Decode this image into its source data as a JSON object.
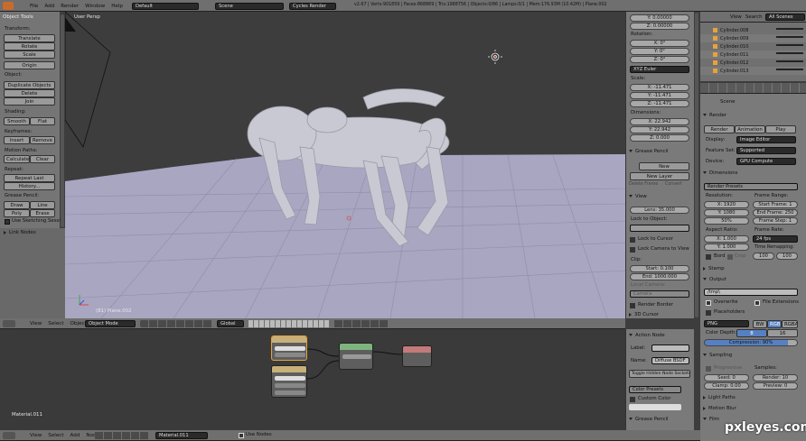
{
  "topbar": {
    "menus": [
      "File",
      "Add",
      "Render",
      "Window",
      "Help"
    ],
    "layout": "Default",
    "scene": "Scene",
    "engine": "Cycles Render",
    "stats": "v2.67 | Verts:901859 | Faces:868869 | Tris:1988756 | Objects:0/86 | Lamps:0/1 | Mem:176.93M (10.42M) | Plane.002"
  },
  "tools": {
    "title": "Object Tools",
    "transform_label": "Transform:",
    "translate": "Translate",
    "rotate": "Rotate",
    "scale": "Scale",
    "origin": "Origin",
    "object_label": "Object:",
    "duplicate": "Duplicate Objects",
    "delete": "Delete",
    "join": "Join",
    "shading_label": "Shading:",
    "smooth": "Smooth",
    "flat": "Flat",
    "keyframes_label": "Keyframes:",
    "insert": "Insert",
    "remove": "Remove",
    "motion_label": "Motion Paths:",
    "calculate": "Calculate",
    "clear": "Clear",
    "repeat_label": "Repeat:",
    "repeat_last": "Repeat Last",
    "history": "History...",
    "grease_label": "Grease Pencil:",
    "draw": "Draw",
    "line": "Line",
    "poly": "Poly",
    "erase": "Erase",
    "sketching": "Use Sketching Sessi",
    "link_nodes": "Link Nodes"
  },
  "viewport": {
    "label": "User Persp",
    "object_name": "(81) Plane.002"
  },
  "viewport_header": {
    "view": "View",
    "select": "Select",
    "object": "Object",
    "mode": "Object Mode",
    "orientation": "Global"
  },
  "props": {
    "y_loc": "Y: 0.00000",
    "z_loc": "Z: 0.00000",
    "rotation_label": "Rotation:",
    "rx": "X: 0°",
    "ry": "Y: 0°",
    "rz": "Z: 0°",
    "rot_mode": "XYZ Euler",
    "scale_label": "Scale:",
    "sx": "X: -11.471",
    "sy": "Y: -11.471",
    "sz": "Z: -11.471",
    "dim_label": "Dimensions:",
    "dx": "X: 22.942",
    "dy": "Y: 22.942",
    "dz": "Z: 0.000",
    "grease": "Grease Pencil",
    "new": "New",
    "new_layer": "New Layer",
    "delete_frame": "Delete Frame",
    "convert": "Convert",
    "view": "View",
    "lens": "Lens: 35.000",
    "lock_obj": "Lock to Object:",
    "lock_cursor": "Lock to Cursor",
    "lock_camera": "Lock Camera to View",
    "clip": "Clip:",
    "start": "Start: 0.100",
    "end": "End: 1000.000",
    "local_camera": "Local Camera:",
    "camera": "Camera",
    "render_border": "Render Border",
    "cursor_3d": "3D Cursor"
  },
  "outliner": {
    "view": "View",
    "search": "Search",
    "all_scenes": "All Scenes",
    "items": [
      "Cylinder.008",
      "Cylinder.009",
      "Cylinder.010",
      "Cylinder.011",
      "Cylinder.012",
      "Cylinder.013"
    ]
  },
  "render": {
    "scene": "Scene",
    "render_hdr": "Render",
    "render_btn": "Render",
    "animation_btn": "Animation",
    "play_btn": "Play",
    "display_label": "Display:",
    "display_val": "Image Editor",
    "feature_label": "Feature Set:",
    "feature_val": "Supported",
    "device_label": "Device:",
    "device_val": "GPU Compute",
    "dimensions": "Dimensions",
    "presets": "Render Presets",
    "resolution": "Resolution:",
    "resx": "X: 1920",
    "resy": "Y: 1080",
    "respct": "50%",
    "frame_range": "Frame Range:",
    "start_frame": "Start Frame: 1",
    "end_frame": "End Frame: 250",
    "frame_step": "Frame Step: 1",
    "aspect": "Aspect Ratio:",
    "ax": "X: 1.000",
    "ay": "Y: 1.000",
    "frame_rate": "Frame Rate:",
    "fps": "24 fps",
    "time_remap": "Time Remapping:",
    "t_old": "100",
    "t_new": "100",
    "border": "Bord",
    "crop": "Crop",
    "stamp": "Stamp",
    "output": "Output",
    "path": "/tmp\\",
    "overwrite": "Overwrite",
    "file_ext": "File Extensions",
    "placeholders": "Placeholders",
    "format": "PNG",
    "bw": "BW",
    "rgb": "RGB",
    "rgba": "RGBA",
    "color_depth": "Color Depth:",
    "depth8": "8",
    "depth16": "16",
    "compression": "Compression: 90%",
    "sampling": "Sampling",
    "progressive": "Progressive",
    "seed": "Seed: 0",
    "clamp": "Clamp: 0.00",
    "samples": "Samples:",
    "render_samples": "Render: 10",
    "preview_samples": "Preview: 0",
    "light_paths": "Light Paths",
    "motion_blur": "Motion Blur",
    "film": "Film"
  },
  "node_editor": {
    "material": "Material.011",
    "action_node": "Action Node",
    "label_lbl": "Label:",
    "name_lbl": "Name:",
    "name_val": "Diffuse BSDF",
    "toggle_hidden": "Toggle Hidden Node Sockets",
    "color_presets": "Color Presets",
    "custom_color": "Custom Color",
    "grease": "Grease Pencil"
  },
  "node_header": {
    "view": "View",
    "select": "Select",
    "add": "Add",
    "node": "Node",
    "material": "Material.011",
    "use_nodes": "Use Nodes"
  },
  "watermark": "pxleyes.com",
  "colors": {
    "viewport_bg": "#3d3d3d",
    "floor": "#a9a6c2",
    "panel": "#727272",
    "accent_blue": "#5680c2",
    "active_node": "#e6a23c"
  }
}
